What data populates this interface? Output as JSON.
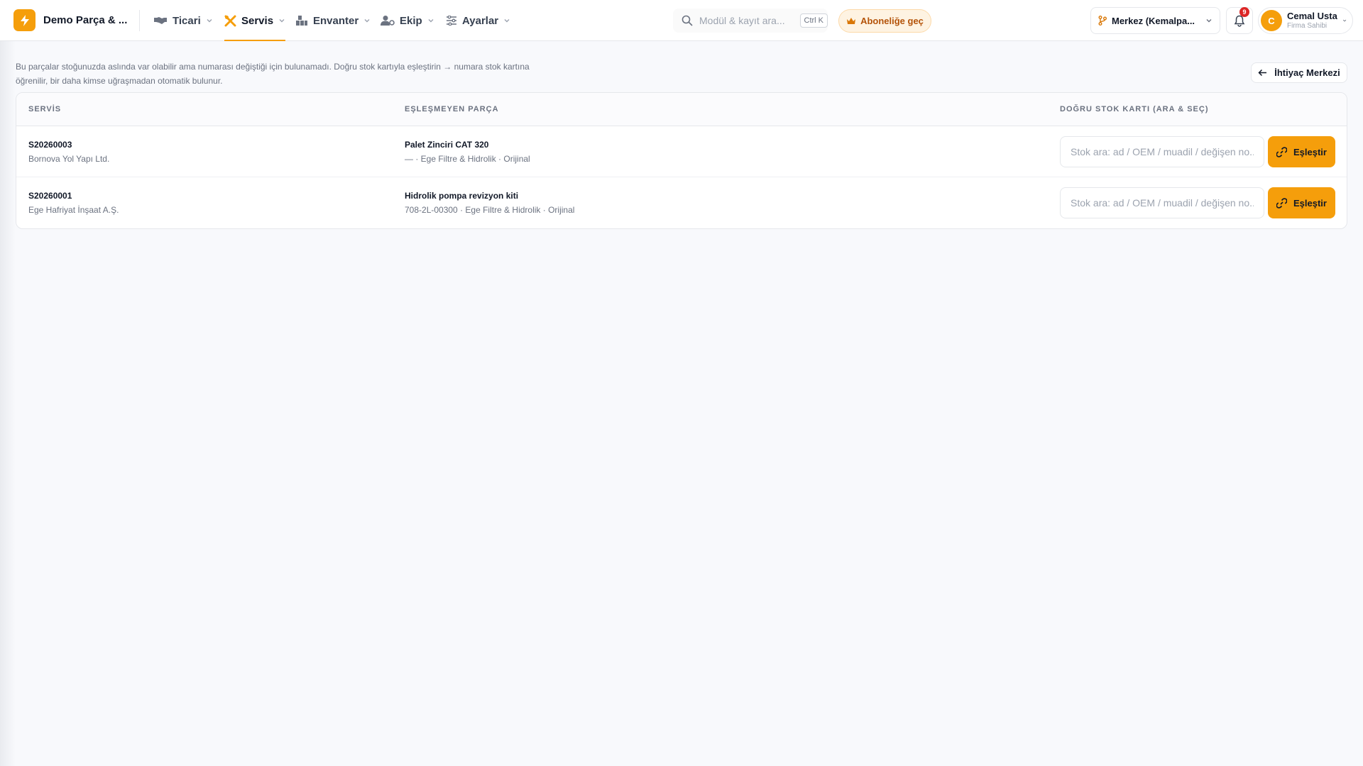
{
  "header": {
    "brand": "Demo Parça & ...",
    "nav": [
      {
        "label": "Ticari",
        "icon": "handshake-icon"
      },
      {
        "label": "Servis",
        "icon": "wrench-screwdriver-icon",
        "active": true
      },
      {
        "label": "Envanter",
        "icon": "warehouse-icon"
      },
      {
        "label": "Ekip",
        "icon": "user-gear-icon"
      },
      {
        "label": "Ayarlar",
        "icon": "sliders-icon"
      }
    ],
    "search_placeholder": "Modül & kayıt ara...",
    "search_shortcut": "Ctrl K",
    "subscribe_label": "Aboneliğe geç",
    "branch_label": "Merkez (Kemalpa...",
    "notification_count": "9",
    "user": {
      "initial": "C",
      "name": "Cemal Usta",
      "role": "Firma Sahibi"
    }
  },
  "info_text": "Bu parçalar stoğunuzda aslında var olabilir ama numarası değiştiği için bulunamadı. Doğru stok kartıyla eşleştirin → numara stok kartına öğrenilir, bir daha kimse uğraşmadan otomatik bulunur.",
  "back_button_label": "İhtiyaç Merkezi",
  "table": {
    "columns": [
      "SERVİS",
      "EŞLEŞMEYEN PARÇA",
      "DOĞRU STOK KARTI (ARA & SEÇ)"
    ],
    "rows": [
      {
        "service_no": "S20260003",
        "customer": "Bornova Yol Yapı Ltd.",
        "part_name": "Palet Zinciri CAT 320",
        "part_details": "— · Ege Filtre & Hidrolik · Orijinal",
        "stock_placeholder": "Stok ara: ad / OEM / muadil / değişen no...",
        "match_label": "Eşleştir"
      },
      {
        "service_no": "S20260001",
        "customer": "Ege Hafriyat İnşaat A.Ş.",
        "part_name": "Hidrolik pompa revizyon kiti",
        "part_details": "708-2L-00300 · Ege Filtre & Hidrolik · Orijinal",
        "stock_placeholder": "Stok ara: ad / OEM / muadil / değişen no...",
        "match_label": "Eşleştir"
      }
    ]
  },
  "colors": {
    "accent": "#f59e0b",
    "badge": "#dc2626",
    "background": "#f8f9fc"
  }
}
